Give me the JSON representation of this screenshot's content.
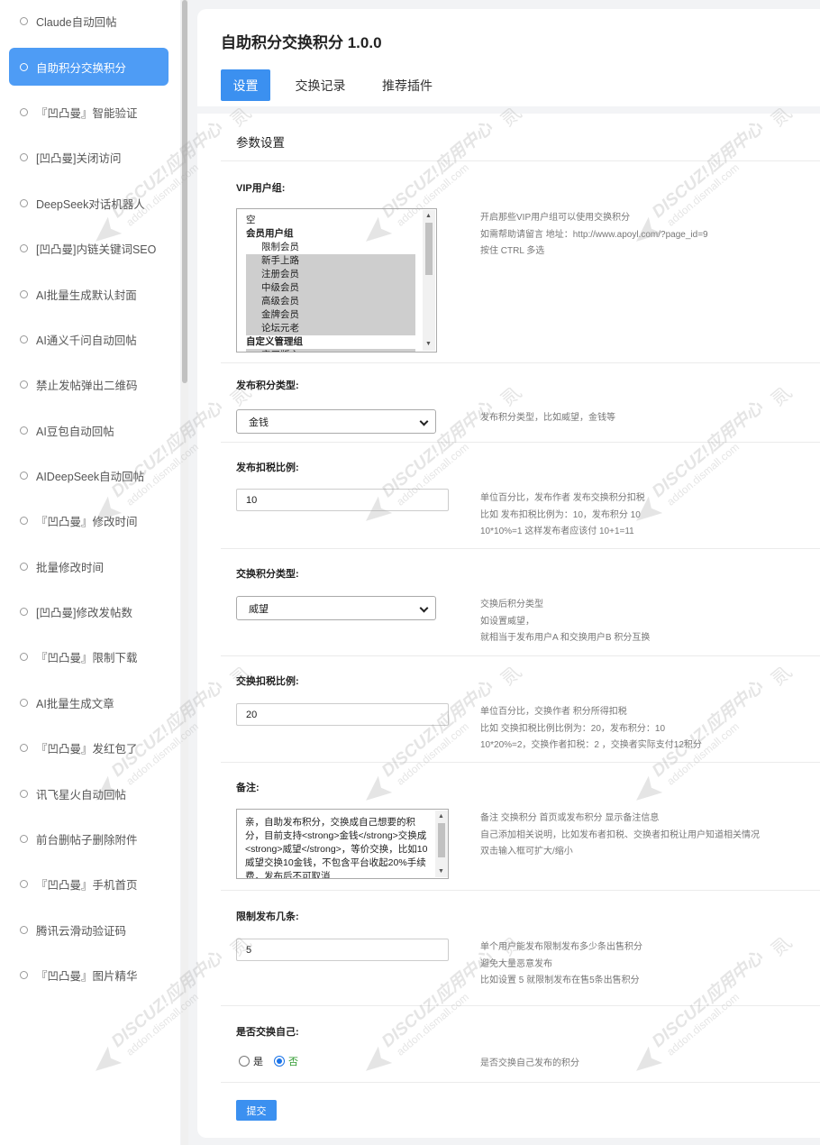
{
  "sidebar": {
    "items": [
      {
        "label": "Claude自动回帖"
      },
      {
        "label": "自助积分交换积分",
        "active": true
      },
      {
        "label": "『凹凸曼』智能验证"
      },
      {
        "label": "[凹凸曼]关闭访问"
      },
      {
        "label": "DeepSeek对话机器人"
      },
      {
        "label": "[凹凸曼]内链关键词SEO"
      },
      {
        "label": "AI批量生成默认封面"
      },
      {
        "label": "AI通义千问自动回帖"
      },
      {
        "label": "禁止发帖弹出二维码"
      },
      {
        "label": "AI豆包自动回帖"
      },
      {
        "label": "AIDeepSeek自动回帖"
      },
      {
        "label": "『凹凸曼』修改时间"
      },
      {
        "label": "批量修改时间"
      },
      {
        "label": "[凹凸曼]修改发帖数"
      },
      {
        "label": "『凹凸曼』限制下载"
      },
      {
        "label": "AI批量生成文章"
      },
      {
        "label": "『凹凸曼』发红包了"
      },
      {
        "label": "讯飞星火自动回帖"
      },
      {
        "label": "前台删帖子删除附件"
      },
      {
        "label": "『凹凸曼』手机首页"
      },
      {
        "label": "腾讯云滑动验证码"
      },
      {
        "label": "『凹凸曼』图片精华"
      }
    ]
  },
  "header": {
    "title": "自助积分交换积分 1.0.0",
    "tabs": [
      "设置",
      "交换记录",
      "推荐插件"
    ]
  },
  "section_title": "参数设置",
  "vip": {
    "label": "VIP用户组:",
    "options": [
      {
        "text": "空",
        "selected": false,
        "group": false,
        "indent": false
      },
      {
        "text": "会员用户组",
        "selected": false,
        "group": true,
        "indent": false
      },
      {
        "text": "限制会员",
        "selected": false,
        "group": false,
        "indent": true
      },
      {
        "text": "新手上路",
        "selected": true,
        "group": false,
        "indent": true
      },
      {
        "text": "注册会员",
        "selected": true,
        "group": false,
        "indent": true
      },
      {
        "text": "中级会员",
        "selected": true,
        "group": false,
        "indent": true
      },
      {
        "text": "高级会员",
        "selected": true,
        "group": false,
        "indent": true
      },
      {
        "text": "金牌会员",
        "selected": true,
        "group": false,
        "indent": true
      },
      {
        "text": "论坛元老",
        "selected": true,
        "group": false,
        "indent": true
      },
      {
        "text": "自定义管理组",
        "selected": false,
        "group": true,
        "indent": false
      },
      {
        "text": "实习版主",
        "selected": true,
        "group": false,
        "indent": true
      }
    ],
    "help": [
      "开启那些VIP用户组可以使用交换积分",
      "如需帮助请留言 地址：http://www.apoyl.com/?page_id=9",
      "按住 CTRL 多选"
    ]
  },
  "publish_type": {
    "label": "发布积分类型:",
    "value": "金钱",
    "help": [
      "发布积分类型，比如威望，金钱等"
    ]
  },
  "publish_tax": {
    "label": "发布扣税比例:",
    "value": "10",
    "help": [
      "单位百分比，发布作者 发布交换积分扣税",
      "比如 发布扣税比例为：10，发布积分 10",
      "10*10%=1 这样发布者应该付 10+1=11"
    ]
  },
  "exchange_type": {
    "label": "交换积分类型:",
    "value": "威望",
    "help": [
      "交换后积分类型",
      "如设置威望，",
      "就相当于发布用户A 和交换用户B 积分互换"
    ]
  },
  "exchange_tax": {
    "label": "交换扣税比例:",
    "value": "20",
    "help": [
      "单位百分比，交换作者 积分所得扣税",
      "比如 交换扣税比例比例为：20，发布积分：10",
      "10*20%=2，交换作者扣税：2 ，交换者实际支付12积分"
    ]
  },
  "remark": {
    "label": "备注:",
    "value": "亲，自助发布积分，交换成自己想要的积分，目前支持<strong>金钱</strong>交换成<strong>威望</strong>，等价交换，比如10威望交换10金钱，不包含平台收起20%手续费，发布后不可取消",
    "help": [
      "备注 交换积分 首页或发布积分 显示备注信息",
      "自己添加相关说明，比如发布者扣税、交换者扣税让用户知道相关情况",
      "双击输入框可扩大/缩小"
    ]
  },
  "limit": {
    "label": "限制发布几条:",
    "value": "5",
    "help": [
      "单个用户能发布限制发布多少条出售积分",
      "避免大量恶意发布",
      "比如设置 5 就限制发布在售5条出售积分"
    ]
  },
  "self_exchange": {
    "label": "是否交换自己:",
    "yes": "是",
    "no": "否",
    "help": [
      "是否交换自己发布的积分"
    ]
  },
  "submit_label": "提交",
  "watermark": {
    "line1": "DISCUZ!应用中心",
    "line2": "addon.dismall.com",
    "brand": "贰道"
  },
  "colors": {
    "accent": "#3b90f0",
    "sidebar_active": "#4e9cf5",
    "selected_option": "#cecece",
    "radio_no_label": "#2e9a2e"
  }
}
